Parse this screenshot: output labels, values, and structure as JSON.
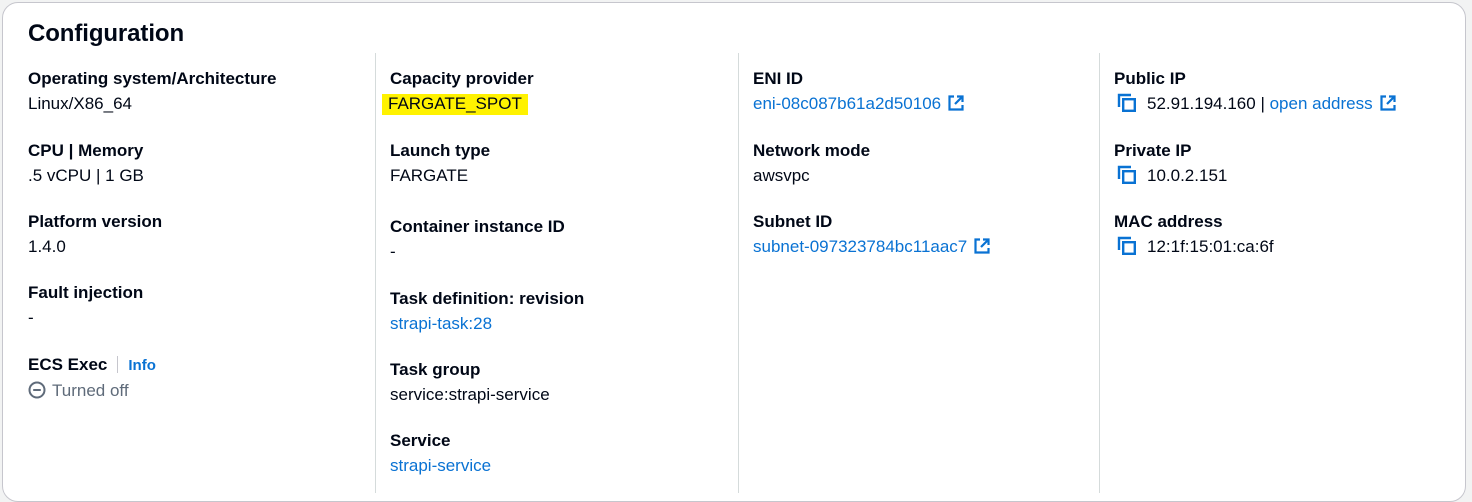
{
  "panel": {
    "title": "Configuration"
  },
  "col1": {
    "os_label": "Operating system/Architecture",
    "os_value": "Linux/X86_64",
    "cpu_label": "CPU | Memory",
    "cpu_value": ".5 vCPU | 1 GB",
    "platform_label": "Platform version",
    "platform_value": "1.4.0",
    "fault_label": "Fault injection",
    "fault_value": "-",
    "ecs_label": "ECS Exec",
    "ecs_info": "Info",
    "ecs_value": "Turned off"
  },
  "col2": {
    "capacity_label": "Capacity provider",
    "capacity_value": "FARGATE_SPOT",
    "launch_label": "Launch type",
    "launch_value": "FARGATE",
    "container_label": "Container instance ID",
    "container_value": "-",
    "taskdef_label": "Task definition: revision",
    "taskdef_value": "strapi-task:28",
    "group_label": "Task group",
    "group_value": "service:strapi-service",
    "service_label": "Service",
    "service_value": "strapi-service"
  },
  "col3": {
    "eni_label": "ENI ID",
    "eni_value": "eni-08c087b61a2d50106",
    "netmode_label": "Network mode",
    "netmode_value": "awsvpc",
    "subnet_label": "Subnet ID",
    "subnet_value": "subnet-097323784bc11aac7"
  },
  "col4": {
    "public_label": "Public IP",
    "public_value": "52.91.194.160",
    "public_sep": " | ",
    "public_link": "open address",
    "private_label": "Private IP",
    "private_value": "10.0.2.151",
    "mac_label": "MAC address",
    "mac_value": "12:1f:15:01:ca:6f"
  },
  "icons": {
    "external": "external-link-icon",
    "copy": "copy-icon",
    "status": "status-stopped-icon"
  },
  "colors": {
    "link": "#0972d3",
    "text": "#000716",
    "muted": "#5f6b7a",
    "highlight": "#fff200",
    "divider": "#d5dbdb"
  }
}
